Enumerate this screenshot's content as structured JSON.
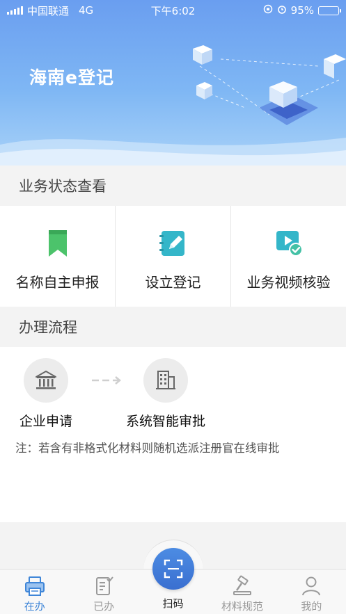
{
  "status_bar": {
    "carrier": "中国联通",
    "network": "4G",
    "time": "下午6:02",
    "battery": "95%",
    "battery_level": 0.95
  },
  "banner": {
    "title": "海南e登记"
  },
  "sections": {
    "status_title": "业务状态查看",
    "flow_title": "办理流程"
  },
  "business": [
    {
      "label": "名称自主申报",
      "icon": "bookmark-icon",
      "color": "#4cc36b"
    },
    {
      "label": "设立登记",
      "icon": "edit-notebook-icon",
      "color": "#34b6c9"
    },
    {
      "label": "业务视频核验",
      "icon": "video-check-icon",
      "color": "#34b6c9"
    }
  ],
  "process": {
    "steps": [
      {
        "label": "企业申请",
        "icon": "bank-icon"
      },
      {
        "label": "系统智能审批",
        "icon": "building-icon"
      }
    ],
    "note": "注：若含有非格式化材料则随机选派注册官在线审批"
  },
  "tabbar": {
    "active_color": "#3f86d8",
    "items": [
      {
        "label": "在办",
        "icon": "printer-icon",
        "active": true
      },
      {
        "label": "已办",
        "icon": "checklist-icon",
        "active": false
      },
      {
        "label": "扫码",
        "icon": "scan-icon",
        "active": false
      },
      {
        "label": "材料规范",
        "icon": "gavel-icon",
        "active": false
      },
      {
        "label": "我的",
        "icon": "user-icon",
        "active": false
      }
    ]
  }
}
